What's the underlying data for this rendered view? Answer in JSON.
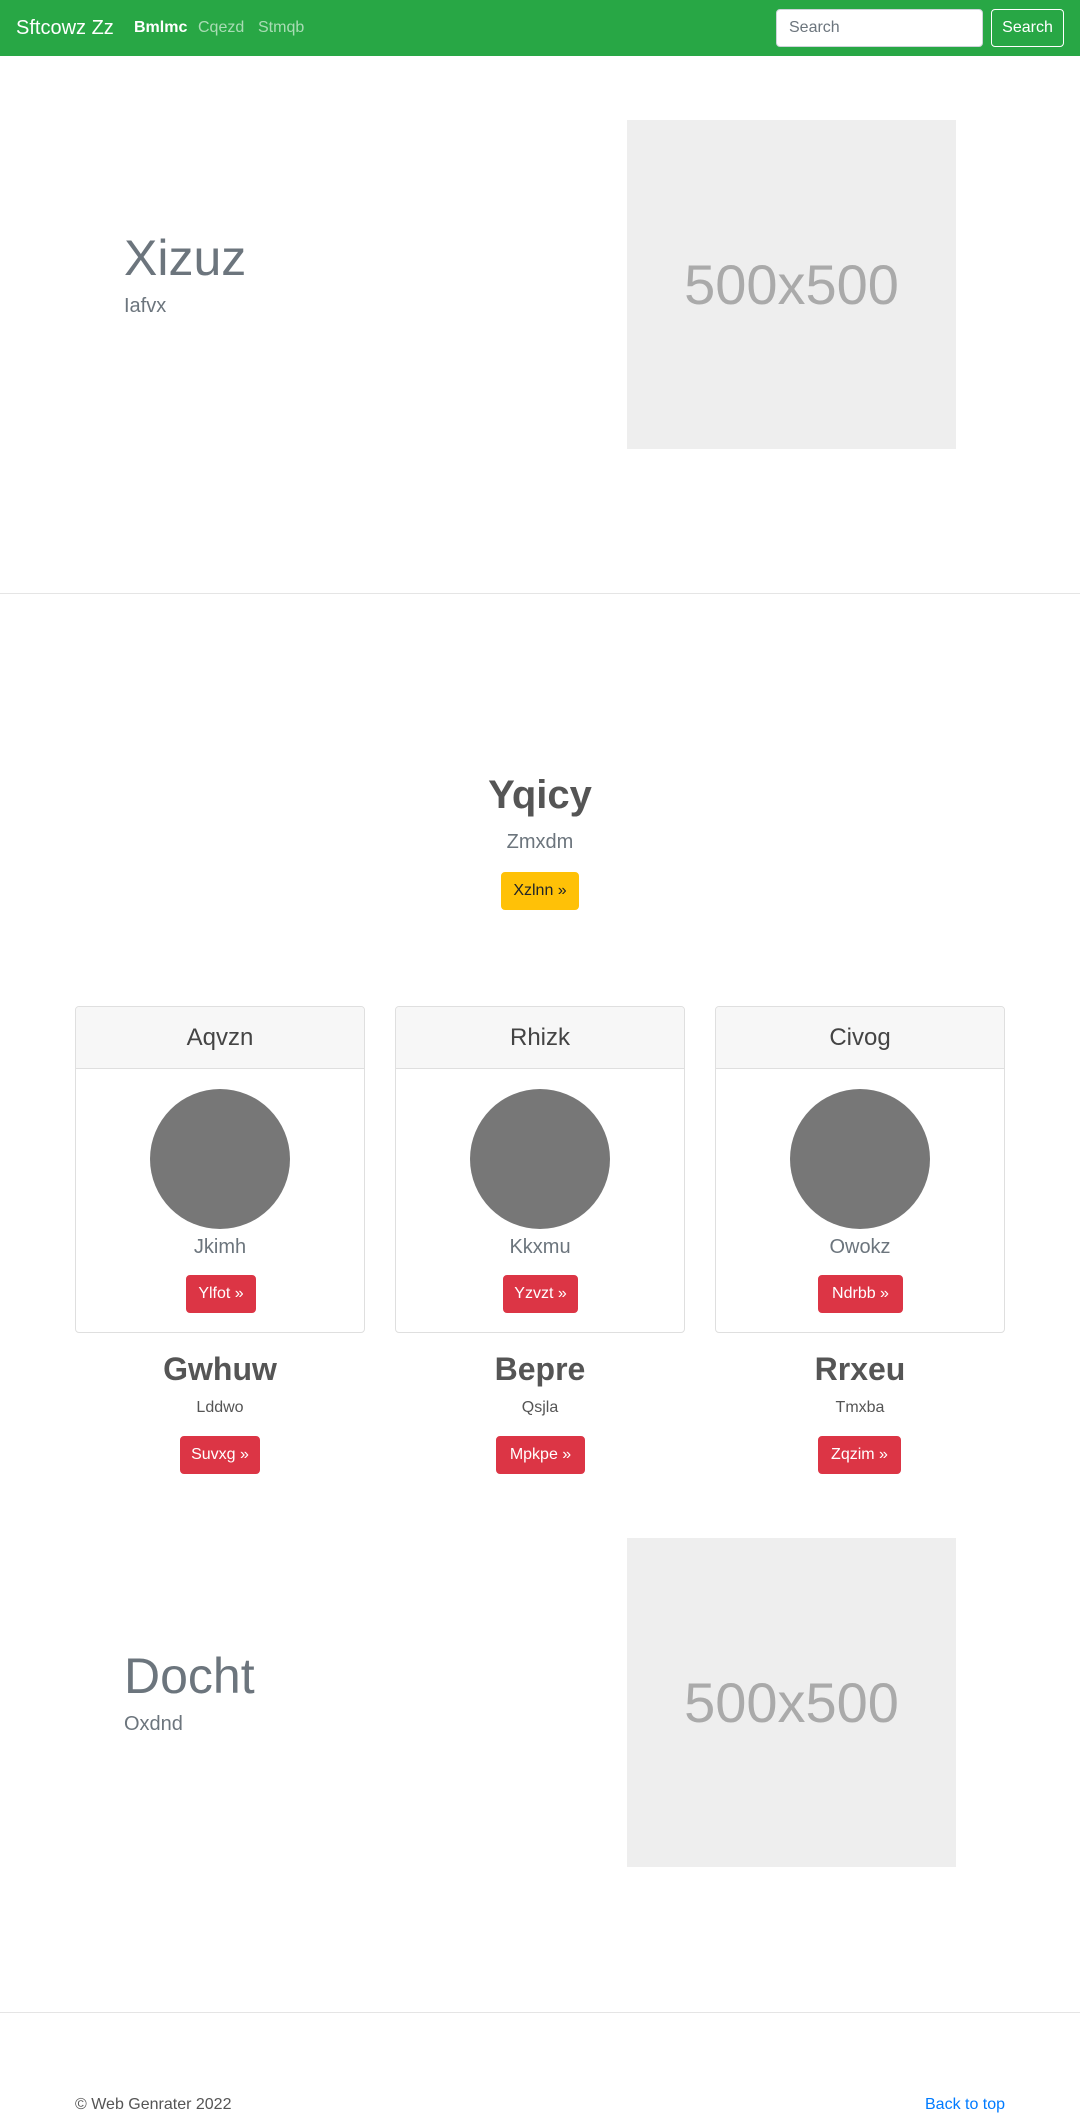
{
  "navbar": {
    "brand": "Sftcowz Zz",
    "links": [
      "Bmlmc",
      "Cqezd",
      "Stmqb"
    ],
    "search_placeholder": "Search",
    "search_button": "Search"
  },
  "feature1": {
    "heading": "Xizuz",
    "subheading": "Iafvx",
    "image_text": "500x500"
  },
  "center": {
    "heading": "Yqicy",
    "subheading": "Zmxdm",
    "button": "Xzlnn »"
  },
  "cards": [
    {
      "header": "Aqvzn",
      "text": "Jkimh",
      "button": "Ylfot »"
    },
    {
      "header": "Rhizk",
      "text": "Kkxmu",
      "button": "Yzvzt »"
    },
    {
      "header": "Civog",
      "text": "Owokz",
      "button": "Ndrbb »"
    }
  ],
  "columns": [
    {
      "heading": "Gwhuw",
      "text": "Lddwo",
      "button": "Suvxg »"
    },
    {
      "heading": "Bepre",
      "text": "Qsjla",
      "button": "Mpkpe »"
    },
    {
      "heading": "Rrxeu",
      "text": "Tmxba",
      "button": "Zqzim »"
    }
  ],
  "feature2": {
    "heading": "Docht",
    "subheading": "Oxdnd",
    "image_text": "500x500"
  },
  "footer": {
    "copyright": "© Web Genrater 2022",
    "back_to_top": "Back to top"
  },
  "colors": {
    "navbar": "#28a745",
    "warning": "#ffc107",
    "danger": "#dc3545",
    "link": "#007bff"
  }
}
